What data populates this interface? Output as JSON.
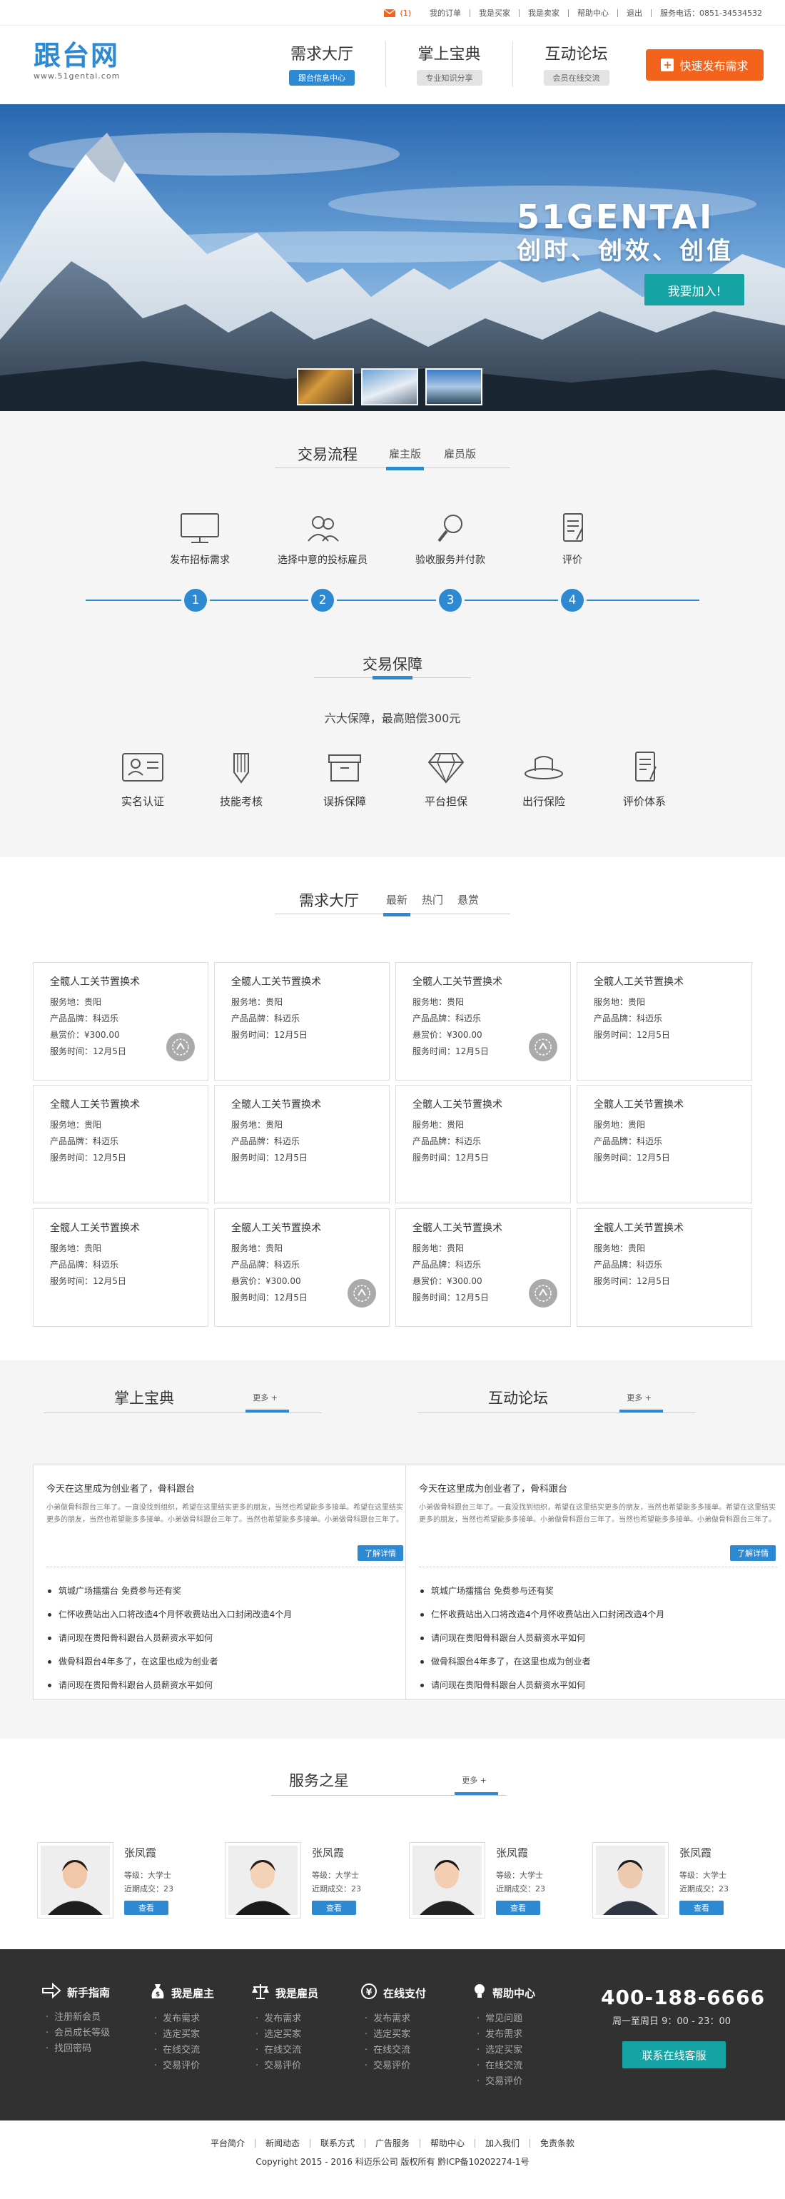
{
  "topbar": {
    "mail_count": "(1)",
    "links": [
      "我的订单",
      "我是买家",
      "我是卖家",
      "帮助中心",
      "退出",
      "服务电话：0851-34534532"
    ]
  },
  "header": {
    "logo_title": "跟台网",
    "logo_sub": "www.51gentai.com",
    "nav": [
      {
        "title": "需求大厅",
        "tag": "跟台信息中心"
      },
      {
        "title": "掌上宝典",
        "tag": "专业知识分享"
      },
      {
        "title": "互动论坛",
        "tag": "会员在线交流"
      }
    ],
    "publish_label": "快速发布需求"
  },
  "banner": {
    "big": "51GENTAI",
    "sub": "创时、创效、创值",
    "join_label": "我要加入!"
  },
  "process": {
    "title": "交易流程",
    "tabs": [
      "雇主版",
      "雇员版"
    ],
    "steps": [
      {
        "label": "发布招标需求",
        "num": "1",
        "icon": "monitor-icon"
      },
      {
        "label": "选择中意的投标雇员",
        "num": "2",
        "icon": "users-icon"
      },
      {
        "label": "验收服务并付款",
        "num": "3",
        "icon": "magnifier-icon"
      },
      {
        "label": "评价",
        "num": "4",
        "icon": "note-icon"
      }
    ]
  },
  "guarantee": {
    "title": "交易保障",
    "desc": "六大保障，最高赔偿300元",
    "items": [
      {
        "label": "实名认证",
        "icon": "id-card-icon"
      },
      {
        "label": "技能考核",
        "icon": "pencil-icon"
      },
      {
        "label": "误拆保障",
        "icon": "box-icon"
      },
      {
        "label": "平台担保",
        "icon": "diamond-icon"
      },
      {
        "label": "出行保险",
        "icon": "hat-icon"
      },
      {
        "label": "评价体系",
        "icon": "note-icon"
      }
    ]
  },
  "demand": {
    "title": "需求大厅",
    "tabs": [
      "最新",
      "热门",
      "悬赏"
    ],
    "cards": [
      {
        "title": "全髋人工关节置换术",
        "lines": [
          "服务地：贵阳",
          "产品品牌：科迈乐",
          "悬赏价：¥300.00",
          "服务时间：12月5日"
        ],
        "stamp": true
      },
      {
        "title": "全髋人工关节置换术",
        "lines": [
          "服务地：贵阳",
          "产品品牌：科迈乐",
          "服务时间：12月5日"
        ],
        "stamp": false
      },
      {
        "title": "全髋人工关节置换术",
        "lines": [
          "服务地：贵阳",
          "产品品牌：科迈乐",
          "悬赏价：¥300.00",
          "服务时间：12月5日"
        ],
        "stamp": true
      },
      {
        "title": "全髋人工关节置换术",
        "lines": [
          "服务地：贵阳",
          "产品品牌：科迈乐",
          "服务时间：12月5日"
        ],
        "stamp": false
      },
      {
        "title": "全髋人工关节置换术",
        "lines": [
          "服务地：贵阳",
          "产品品牌：科迈乐",
          "服务时间：12月5日"
        ],
        "stamp": false
      },
      {
        "title": "全髋人工关节置换术",
        "lines": [
          "服务地：贵阳",
          "产品品牌：科迈乐",
          "服务时间：12月5日"
        ],
        "stamp": false
      },
      {
        "title": "全髋人工关节置换术",
        "lines": [
          "服务地：贵阳",
          "产品品牌：科迈乐",
          "服务时间：12月5日"
        ],
        "stamp": false
      },
      {
        "title": "全髋人工关节置换术",
        "lines": [
          "服务地：贵阳",
          "产品品牌：科迈乐",
          "服务时间：12月5日"
        ],
        "stamp": false
      },
      {
        "title": "全髋人工关节置换术",
        "lines": [
          "服务地：贵阳",
          "产品品牌：科迈乐",
          "服务时间：12月5日"
        ],
        "stamp": false
      },
      {
        "title": "全髋人工关节置换术",
        "lines": [
          "服务地：贵阳",
          "产品品牌：科迈乐",
          "悬赏价：¥300.00",
          "服务时间：12月5日"
        ],
        "stamp": true
      },
      {
        "title": "全髋人工关节置换术",
        "lines": [
          "服务地：贵阳",
          "产品品牌：科迈乐",
          "悬赏价：¥300.00",
          "服务时间：12月5日"
        ],
        "stamp": true
      },
      {
        "title": "全髋人工关节置换术",
        "lines": [
          "服务地：贵阳",
          "产品品牌：科迈乐",
          "服务时间：12月5日"
        ],
        "stamp": false
      }
    ]
  },
  "pair": [
    {
      "title": "掌上宝典",
      "more": "更多 +",
      "headline": "今天在这里成为创业者了，骨科跟台",
      "para": "小弟做骨科跟台三年了。一直没找到组织，希望在这里结实更多的朋友，当然也希望能多多接单。希望在这里结实更多的朋友，当然也希望能多多接单。小弟做骨科跟台三年了。当然也希望能多多接单。小弟做骨科跟台三年了。",
      "detail_label": "了解详情",
      "items": [
        "筑城广场擂擂台 免费参与还有奖",
        "仁怀收费站出入口将改造4个月怀收费站出入口封闭改造4个月",
        "请问现在贵阳骨科跟台人员薪资水平如何",
        "做骨科跟台4年多了，在这里也成为创业者",
        "请问现在贵阳骨科跟台人员薪资水平如何"
      ]
    },
    {
      "title": "互动论坛",
      "more": "更多 +",
      "headline": "今天在这里成为创业者了，骨科跟台",
      "para": "小弟做骨科跟台三年了。一直没找到组织，希望在这里结实更多的朋友，当然也希望能多多接单。希望在这里结实更多的朋友，当然也希望能多多接单。小弟做骨科跟台三年了。当然也希望能多多接单。小弟做骨科跟台三年了。",
      "detail_label": "了解详情",
      "items": [
        "筑城广场擂擂台 免费参与还有奖",
        "仁怀收费站出入口将改造4个月怀收费站出入口封闭改造4个月",
        "请问现在贵阳骨科跟台人员薪资水平如何",
        "做骨科跟台4年多了，在这里也成为创业者",
        "请问现在贵阳骨科跟台人员薪资水平如何"
      ]
    }
  ],
  "stars": {
    "title": "服务之星",
    "more": "更多 +",
    "people": [
      {
        "name": "张凤霞",
        "level": "等级：大学士",
        "deals": "近期成交：23",
        "btn": "查看"
      },
      {
        "name": "张凤霞",
        "level": "等级：大学士",
        "deals": "近期成交：23",
        "btn": "查看"
      },
      {
        "name": "张凤霞",
        "level": "等级：大学士",
        "deals": "近期成交：23",
        "btn": "查看"
      },
      {
        "name": "张凤霞",
        "level": "等级：大学士",
        "deals": "近期成交：23",
        "btn": "查看"
      }
    ]
  },
  "footer": {
    "cols": [
      {
        "title": "新手指南",
        "icon": "arrow-right-icon",
        "items": [
          "注册新会员",
          "会员成长等级",
          "找回密码"
        ]
      },
      {
        "title": "我是雇主",
        "icon": "money-bag-icon",
        "items": [
          "发布需求",
          "选定买家",
          "在线交流",
          "交易评价"
        ]
      },
      {
        "title": "我是雇员",
        "icon": "scale-icon",
        "items": [
          "发布需求",
          "选定买家",
          "在线交流",
          "交易评价"
        ]
      },
      {
        "title": "在线支付",
        "icon": "yen-circle-icon",
        "items": [
          "发布需求",
          "选定买家",
          "在线交流",
          "交易评价"
        ]
      },
      {
        "title": "帮助中心",
        "icon": "bulb-icon",
        "items": [
          "常见问题",
          "发布需求",
          "选定买家",
          "在线交流",
          "交易评价"
        ]
      }
    ],
    "phone": "400-188-6666",
    "hours": "周一至周日 9：00 - 23：00",
    "service_label": "联系在线客服"
  },
  "bottom": {
    "links": [
      "平台简介",
      "新闻动态",
      "联系方式",
      "广告服务",
      "帮助中心",
      "加入我们",
      "免责条款"
    ],
    "copyright": "Copyright 2015 - 2016 科迈乐公司 版权所有 黔ICP备10202274-1号"
  },
  "colors": {
    "brand_blue": "#2d8ad2",
    "orange": "#f4631c",
    "teal": "#16a3a3"
  }
}
